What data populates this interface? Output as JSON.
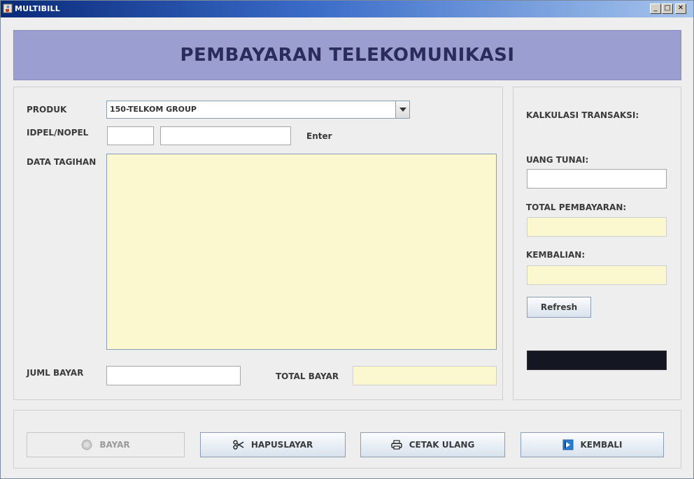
{
  "window": {
    "title": "MULTIBILL",
    "controls": {
      "minimize": "_",
      "maximize": "□",
      "close": "✕"
    }
  },
  "banner": {
    "title": "PEMBAYARAN TELEKOMUNIKASI"
  },
  "form": {
    "produk_label": "PRODUK",
    "produk_value": "150-TELKOM GROUP",
    "idpel_label": "IDPEL/NOPEL",
    "idpel_prefix_value": "",
    "idpel_number_value": "",
    "enter_label": "Enter",
    "data_tagihan_label": "DATA TAGIHAN",
    "data_tagihan_value": "",
    "juml_bayar_label": "JUML BAYAR",
    "juml_bayar_value": "",
    "total_bayar_label": "TOTAL BAYAR",
    "total_bayar_value": ""
  },
  "calc": {
    "title": "KALKULASI  TRANSAKSI:",
    "uang_tunai_label": "UANG TUNAI:",
    "uang_tunai_value": "",
    "total_pembayaran_label": "TOTAL PEMBAYARAN:",
    "total_pembayaran_value": "",
    "kembalian_label": "KEMBALIAN:",
    "kembalian_value": "",
    "refresh_label": "Refresh"
  },
  "actions": {
    "bayar": "BAYAR",
    "hapuslayar": "HAPUSLAYAR",
    "cetak_ulang": "CETAK ULANG",
    "kembali": "KEMBALI"
  },
  "icons": {
    "app": "java-cup-icon",
    "bayar": "coin-icon",
    "hapuslayar": "scissors-icon",
    "cetak_ulang": "printer-icon",
    "kembali": "exit-icon"
  },
  "colors": {
    "banner": "#9a9ed0",
    "banner_text": "#2b2c5e",
    "readonly_field": "#fbf8d0",
    "status_box": "#141722"
  }
}
